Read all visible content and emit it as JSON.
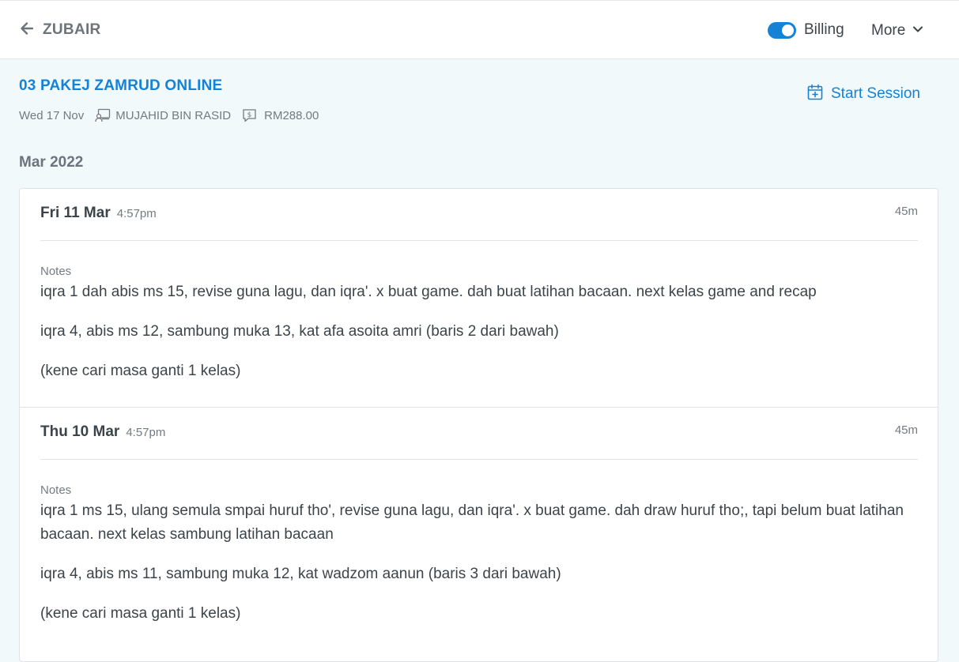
{
  "header": {
    "back_label": "ZUBAIR",
    "billing_label": "Billing",
    "billing_enabled": true,
    "more_label": "More"
  },
  "package": {
    "title": "03 PAKEJ ZAMRUD ONLINE",
    "date": "Wed 17 Nov",
    "teacher": "MUJAHID BIN RASID",
    "price": "RM288.00",
    "start_session_label": "Start Session"
  },
  "month_label": "Mar 2022",
  "sessions": [
    {
      "date": "Fri 11 Mar",
      "time": "4:57pm",
      "duration": "45m",
      "notes_label": "Notes",
      "notes": [
        "iqra 1 dah abis ms 15, revise guna lagu, dan iqra'. x buat game. dah buat latihan bacaan. next kelas game and recap",
        "iqra 4, abis ms 12, sambung muka 13, kat afa asoita amri (baris 2 dari bawah)",
        "(kene cari masa ganti 1 kelas)"
      ]
    },
    {
      "date": "Thu 10 Mar",
      "time": "4:57pm",
      "duration": "45m",
      "notes_label": "Notes",
      "notes": [
        "iqra 1 ms 15, ulang semula smpai huruf tho', revise guna lagu, dan iqra'. x buat game. dah draw huruf tho;, tapi belum buat latihan bacaan. next kelas sambung latihan bacaan",
        "iqra 4, abis ms 11, sambung muka 12, kat wadzom aanun (baris 3 dari bawah)",
        "(kene cari masa ganti 1 kelas)"
      ]
    }
  ],
  "colors": {
    "accent": "#1482d6",
    "background": "#f1f9fa",
    "text": "#3d4449",
    "muted": "#737b81"
  }
}
